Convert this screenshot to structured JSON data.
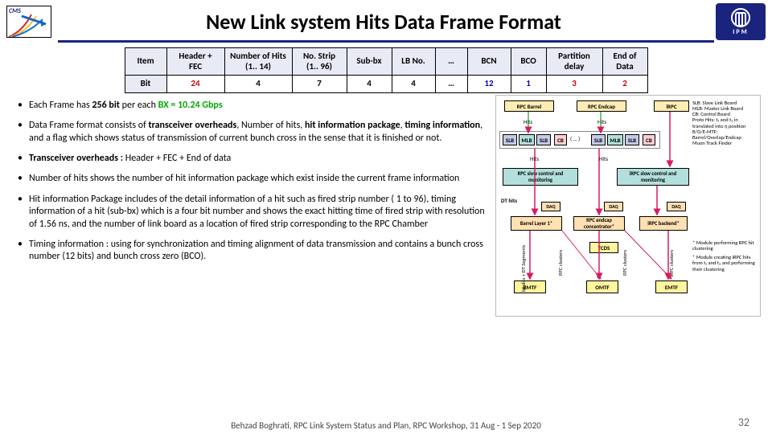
{
  "header": {
    "title": "New Link system Hits Data Frame Format",
    "logo_cms": "CMS",
    "logo_ipm": "IPM"
  },
  "table": {
    "row1": {
      "c0": "Item",
      "c1": "Header + FEC",
      "c2": "Number of Hits (1.. 14)",
      "c3": "No. Strip (1.. 96)",
      "c4": "Sub-bx",
      "c5": "LB No.",
      "c6": "…",
      "c7": "BCN",
      "c8": "BCO",
      "c9": "Partition delay",
      "c10": "End of Data"
    },
    "row2": {
      "c0": "Bit",
      "c1": "24",
      "c2": "4",
      "c3": "7",
      "c4": "4",
      "c5": "4",
      "c6": "…",
      "c7": "12",
      "c8": "1",
      "c9": "3",
      "c10": "2"
    }
  },
  "bullets": {
    "b1a": "Each Frame has ",
    "b1b": "256 bit",
    "b1c": " per each ",
    "b1d": "BX = 10.24 Gbps",
    "b2a": "Data Frame format consists of ",
    "b2b": "transceiver overheads",
    "b2c": ", Number of hits, ",
    "b2d": "hit information package",
    "b2e": ", ",
    "b2f": "timing information",
    "b2g": ", and a flag which shows status of transmission of current bunch cross in the sense that it is finished or not.",
    "b3a": "Transceiver overheads : ",
    "b3b": " Header + FEC + End of data",
    "b4": "Number of hits shows the number of hit information package which exist inside the current frame information",
    "b5": "Hit information Package includes of the detail information of a hit such as fired strip number ( 1 to 96), timing information of a hit (sub-bx) which is a four bit number and shows the exact hitting time of fired strip with resolution of 1.56 ns, and the number of link board as a location of fired strip corresponding to the RPC Chamber",
    "b6": "Timing information : using for synchronization and timing alignment of data transmission and contains a bunch cross number (12 bits) and bunch cross zero (BCO)."
  },
  "diagram": {
    "rpc_barrel": "RPC Barrel",
    "rpc_endcap": "RPC Endcap",
    "irpc": "iRPC",
    "slb": "SLB",
    "mlb": "MLB",
    "cb": "CB",
    "dots": "( … )",
    "hits": "Hits",
    "rpc_slow": "RPC slow control and monitoring",
    "irpc_slow": "iRPC slow control and monitoring",
    "dt_hits": "DT hits",
    "barrel_layer": "Barrel Layer 1*",
    "rpc_endcap_conc": "RPC endcap concentrator*",
    "irpc_backend": "iRPC backend*",
    "daq": "DAQ",
    "tcds": "TCDS",
    "bmtf": "BMTF",
    "omtf": "OMTF",
    "emtf": "EMTF",
    "side1": "SLB: Slave Link Board",
    "side2": "MLB: Master Link Board",
    "side3": "CB: Control Board",
    "side4": "Proto Hits: t₁ and t₂ in",
    "side5": "translated into η position",
    "side6": "B/O/E-MTF:",
    "side7": "Barrel/Overlap/Endcap",
    "side8": "Muon Track Finder",
    "side9": "* Module performing RPC hit clustering",
    "side10": "* Module creating iRPC hits from t₁ and t₂ and performing their clustering",
    "vert1": "bSplits + DT Segments",
    "vert2": "RPC clusters",
    "vert3": "RPC clusters",
    "vert4": "iRPC clusters"
  },
  "footer": {
    "text": "Behzad Boghrati, RPC Link System Status and Plan, RPC Workshop, 31 Aug - 1 Sep 2020",
    "slide": "32"
  }
}
